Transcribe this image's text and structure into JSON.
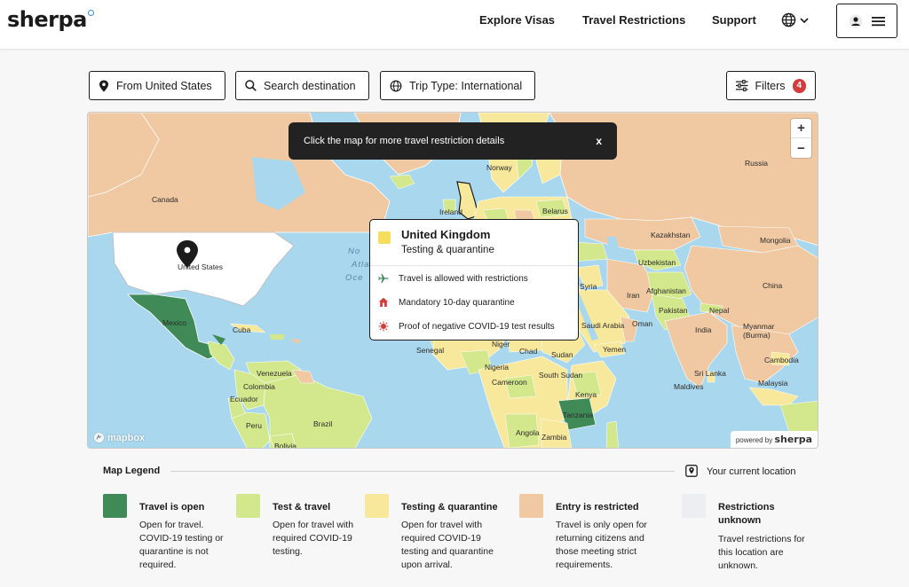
{
  "header": {
    "logo": "sherpa",
    "nav": [
      "Explore Visas",
      "Travel Restrictions",
      "Support"
    ]
  },
  "controls": {
    "origin": "From United States",
    "search": "Search destination",
    "trip_type": "Trip Type: International",
    "filters": "Filters",
    "filter_count": "4"
  },
  "map": {
    "hint": "Click the map for more travel restriction details",
    "hint_close": "x",
    "zoom_in": "+",
    "zoom_out": "−",
    "attribution": "mapbox",
    "powered_by": "powered by",
    "powered_brand": "sherpa",
    "ocean_labels": [
      "No",
      "Atla",
      "Oce"
    ],
    "country_labels": {
      "us": "United States",
      "canada": "Canada",
      "mexico": "Mexico",
      "cuba": "Cuba",
      "venezuela": "Venezuela",
      "colombia": "Colombia",
      "ecuador": "Ecuador",
      "peru": "Peru",
      "brazil": "Brazil",
      "bolivia": "Bolivia",
      "norway": "Norway",
      "ireland": "Ireland",
      "belarus": "Belarus",
      "russia": "Russia",
      "kazakhstan": "Kazakhstan",
      "mongolia": "Mongolia",
      "uzbekistan": "Uzbekistan",
      "china": "China",
      "iran": "Iran",
      "afghanistan": "Afghanistan",
      "pakistan": "Pakistan",
      "nepal": "Nepal",
      "syria": "Syria",
      "saudi": "Saudi Arabia",
      "india": "India",
      "myanmar": "Myanmar\n(Burma)",
      "yemen": "Yemen",
      "oman": "Oman",
      "senegal": "Senegal",
      "niger": "Niger",
      "chad": "Chad",
      "sudan": "Sudan",
      "nigeria": "Nigeria",
      "cameroon": "Cameroon",
      "south_sudan": "South Sudan",
      "kenya": "Kenya",
      "tanzania": "Tanzania",
      "angola": "Angola",
      "zambia": "Zambia",
      "sri_lanka": "Sri Lanka",
      "maldives": "Maldives",
      "cambodia": "Cambodia",
      "malaysia": "Malaysia"
    },
    "popup": {
      "country": "United Kingdom",
      "status": "Testing & quarantine",
      "items": [
        {
          "icon": "plane-icon",
          "text": "Travel is allowed with restrictions"
        },
        {
          "icon": "house-icon",
          "text": "Mandatory 10-day quarantine"
        },
        {
          "icon": "virus-icon",
          "text": "Proof of negative COVID-19 test results"
        }
      ]
    }
  },
  "legend": {
    "title": "Map Legend",
    "current_location": "Your current location",
    "items": [
      {
        "name": "Travel is open",
        "desc": "Open for travel. COVID-19 testing or quarantine is not required.",
        "color": "#3f8a57"
      },
      {
        "name": "Test & travel",
        "desc": "Open for travel with required COVID-19 testing.",
        "color": "#d3e88c"
      },
      {
        "name": "Testing & quarantine",
        "desc": "Open for travel with required COVID-19 testing and quarantine upon arrival.",
        "color": "#f8e89c"
      },
      {
        "name": "Entry is restricted",
        "desc": "Travel is only open for returning citizens and those meeting strict requirements.",
        "color": "#f0c9a3"
      },
      {
        "name": "Restrictions unknown",
        "desc": "Travel restrictions for this location are unknown.",
        "color": "#eceef2"
      }
    ]
  },
  "colors": {
    "open": "#3f8a57",
    "test": "#d3e88c",
    "quarantine": "#f8e89c",
    "restricted": "#f0c9a3",
    "unknown": "#eceef2",
    "water": "#a9d8ee"
  }
}
